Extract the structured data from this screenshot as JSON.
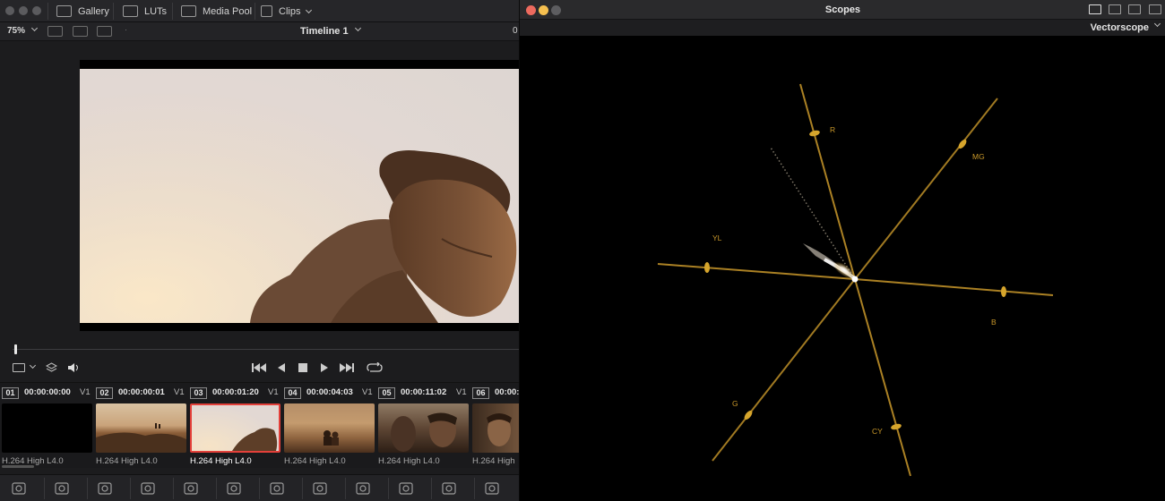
{
  "left": {
    "nav": {
      "gallery": "Gallery",
      "luts": "LUTs",
      "media_pool": "Media Pool",
      "clips": "Clips"
    },
    "viewer": {
      "zoom": "75%",
      "timeline": "Timeline 1",
      "timecode_edge": "0",
      "playhead_fraction": 0.004
    },
    "clips": [
      {
        "num": "01",
        "timecode": "00:00:00:00",
        "track": "V1",
        "codec": "H.264 High L4.0",
        "selected": false
      },
      {
        "num": "02",
        "timecode": "00:00:00:01",
        "track": "V1",
        "codec": "H.264 High L4.0",
        "selected": false
      },
      {
        "num": "03",
        "timecode": "00:00:01:20",
        "track": "V1",
        "codec": "H.264 High L4.0",
        "selected": true
      },
      {
        "num": "04",
        "timecode": "00:00:04:03",
        "track": "V1",
        "codec": "H.264 High L4.0",
        "selected": false
      },
      {
        "num": "05",
        "timecode": "00:00:11:02",
        "track": "V1",
        "codec": "H.264 High L4.0",
        "selected": false
      },
      {
        "num": "06",
        "timecode": "00:00:",
        "track": "",
        "codec": "H.264 High",
        "selected": false
      }
    ],
    "page_icons": [
      "camera-raw-icon",
      "color-match-icon",
      "primaries-icon",
      "hdr-icon",
      "rgb-mixer-icon",
      "motion-effects-icon",
      "curves-icon",
      "color-warper-icon",
      "qualifier-icon",
      "window-icon",
      "tracker-icon",
      "magic-mask-icon"
    ]
  },
  "scopes": {
    "title": "Scopes",
    "type": "Vectorscope",
    "targets": [
      "R",
      "MG",
      "B",
      "CY",
      "G",
      "YL"
    ],
    "colors": {
      "graticule": "#c9982a",
      "trace": "#f4ead8"
    }
  }
}
